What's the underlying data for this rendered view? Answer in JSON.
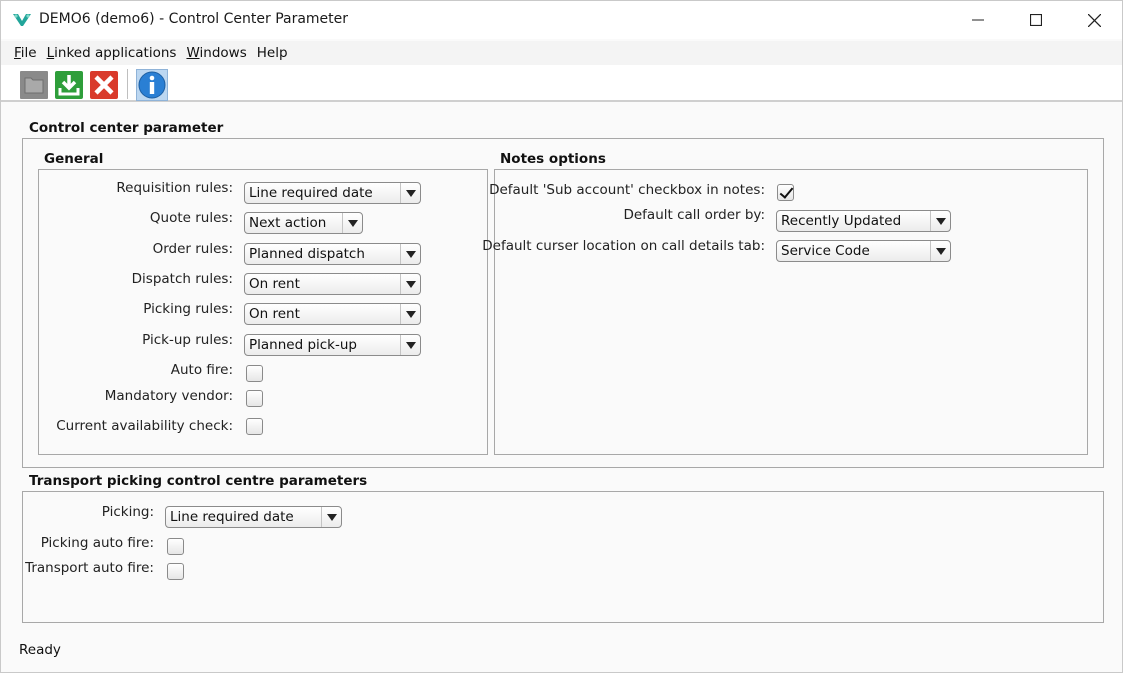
{
  "window": {
    "title": "DEMO6 (demo6) - Control Center Parameter"
  },
  "menu": {
    "items": [
      {
        "key": "F",
        "rest": "ile"
      },
      {
        "key": "L",
        "rest": "inked applications"
      },
      {
        "key": "W",
        "rest": "indows"
      },
      {
        "key": "",
        "rest": "Help"
      }
    ]
  },
  "toolbar": {
    "icons": [
      "folder-icon",
      "save-download-icon",
      "delete-x-icon",
      "info-icon"
    ]
  },
  "control_center": {
    "title": "Control center parameter",
    "general": {
      "title": "General",
      "requisition_label": "Requisition rules:",
      "requisition_value": "Line required date",
      "quote_label": "Quote rules:",
      "quote_value": "Next action",
      "order_label": "Order rules:",
      "order_value": "Planned dispatch",
      "dispatch_label": "Dispatch rules:",
      "dispatch_value": "On rent",
      "picking_label": "Picking rules:",
      "picking_value": "On rent",
      "pickup_label": "Pick-up rules:",
      "pickup_value": "Planned pick-up",
      "autofire_label": "Auto fire:",
      "mandatory_vendor_label": "Mandatory vendor:",
      "availability_label": "Current availability check:"
    },
    "notes": {
      "title": "Notes options",
      "sub_account_label": "Default 'Sub account' checkbox in notes:",
      "call_order_label": "Default call order by:",
      "call_order_value": "Recently Updated",
      "curser_label": "Default curser location on call details tab:",
      "curser_value": "Service Code"
    }
  },
  "transport": {
    "title": "Transport picking control centre parameters",
    "picking_label": "Picking:",
    "picking_value": "Line required date",
    "picking_autofire_label": "Picking auto fire:",
    "transport_autofire_label": "Transport auto fire:"
  },
  "status": {
    "text": "Ready"
  },
  "colors": {
    "accent_green": "#2e9e3a",
    "delete_red": "#d93a2b",
    "info_blue": "#2a7fd4"
  }
}
